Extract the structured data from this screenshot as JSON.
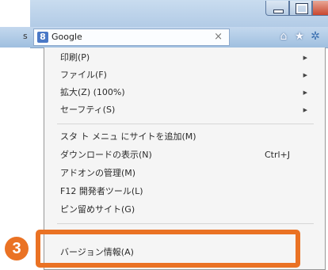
{
  "window": {
    "controls": {
      "minimize": "minimize",
      "maximize": "maximize",
      "close": "x"
    }
  },
  "tab": {
    "favicon": "g-icon",
    "favicon_text": "8",
    "title": "Google",
    "close": "×"
  },
  "toolbar": {
    "icons": [
      "home-icon",
      "star-icon",
      "gear-icon"
    ],
    "home": "⌂",
    "star": "★",
    "gear": "✲"
  },
  "left_strip": {
    "fragment": "s"
  },
  "menu": {
    "group1": [
      {
        "label": "印刷(P)",
        "has_submenu": true
      },
      {
        "label": "ファイル(F)",
        "has_submenu": true
      },
      {
        "label": "拡大(Z) (100%)",
        "has_submenu": true
      },
      {
        "label": "セーフティ(S)",
        "has_submenu": true
      }
    ],
    "group2": [
      {
        "label": "スタ ト メニュ にサイトを追加(M)"
      },
      {
        "label": "ダウンロードの表示(N)",
        "shortcut": "Ctrl+J"
      },
      {
        "label": "アドオンの管理(M)"
      },
      {
        "label": "F12 開発者ツール(L)"
      },
      {
        "label": "ピン留めサイト(G)"
      }
    ],
    "group3": [
      {
        "label": "バージョン情報(A)"
      }
    ],
    "submenu_arrow": "▶"
  },
  "callout": {
    "number": "3",
    "color": "#ea7224"
  }
}
